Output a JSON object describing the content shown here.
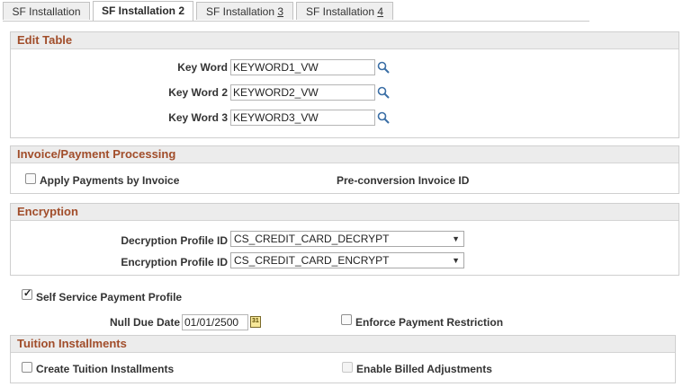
{
  "tabs": [
    {
      "label": "SF Installation"
    },
    {
      "label": "SF Installation 2"
    },
    {
      "label": "SF Installation ",
      "underline": "3"
    },
    {
      "label": "SF Installation ",
      "underline": "4"
    }
  ],
  "edit_table": {
    "title": "Edit Table",
    "rows": [
      {
        "label": "Key Word",
        "value": "KEYWORD1_VW"
      },
      {
        "label": "Key Word 2",
        "value": "KEYWORD2_VW"
      },
      {
        "label": "Key Word 3",
        "value": "KEYWORD3_VW"
      }
    ]
  },
  "invoice": {
    "title": "Invoice/Payment Processing",
    "apply_label": "Apply Payments by Invoice",
    "preconv_label": "Pre-conversion Invoice ID"
  },
  "encryption": {
    "title": "Encryption",
    "decrypt_label": "Decryption Profile ID",
    "decrypt_value": "CS_CREDIT_CARD_DECRYPT",
    "encrypt_label": "Encryption Profile ID",
    "encrypt_value": "CS_CREDIT_CARD_ENCRYPT"
  },
  "self_service": {
    "label": "Self Service Payment Profile"
  },
  "null_due": {
    "label": "Null Due Date",
    "value": "01/01/2500",
    "cal_text": "31"
  },
  "enforce": {
    "label": "Enforce Payment Restriction"
  },
  "tuition": {
    "title": "Tuition Installments",
    "create_label": "Create Tuition Installments",
    "billed_label": "Enable Billed Adjustments"
  },
  "colors": {
    "header_text": "#a14d2a",
    "header_bg": "#ececec",
    "border": "#cfcfcf"
  }
}
